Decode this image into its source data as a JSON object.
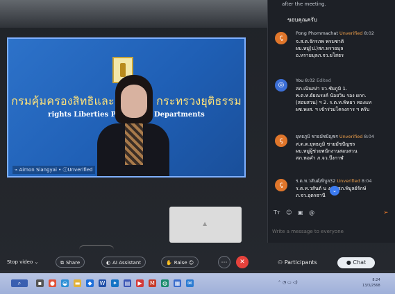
{
  "video": {
    "banner_thai": "กรมคุ้มครองสิทธิและเสรีภาพ กระทรวงยุติธรรม",
    "banner_en": "rights Liberties Protection Departments",
    "participant_name": "Aimon Siangyai",
    "participant_status": "Unverified"
  },
  "chat": {
    "header_partial": "after the meeting.",
    "thanks": "ขอบคุณครับ",
    "messages": [
      {
        "author": "Pong Phommachat",
        "badge": "Unverified",
        "time": "8:02",
        "edited": "",
        "lines": [
          "จ.ส.ต.จักรภพ พรมชาติ",
          "ผบ.หมู่(ป.)สภ.หรายมุล",
          "อ.หรายมุลภ.จว.ยโสธร"
        ]
      },
      {
        "author": "You",
        "badge": "",
        "time": "8:02",
        "edited": "Edited",
        "lines": [
          "สภ.เนินสง่า จว.ชัยภูมิ 1.",
          "พ.ต.ท.ยัยณรงค์ น้อยวิน รอง ผกก.",
          "(สอบสวน) ฯ 2. ร.ต.ท.พิทยา ทองแท",
          "ผช.พงส. ฯ เข้าร่วมโครงการ ฯ ครับ"
        ]
      },
      {
        "author": "ยุทธภูมิ ชายมัชปัญชร",
        "badge": "Unverified",
        "time": "8:04",
        "edited": "",
        "lines": [
          "ส.ต.ต.ยุทธภูมิ ชายมัชปัญชร",
          "ผบ.หมู่ผู้ช่วยพนักงานสอบสวน",
          "สภ.หอคำ ภ.จว.บึงกาฬ"
        ]
      },
      {
        "author": "ร.ต.ท.วสันต์/พิบูล32",
        "badge": "Unverified",
        "time": "8:04",
        "edited": "",
        "lines": [
          "ร.ต.ท.วสันต์ น      งศรี สภ.พิบูลย์รักษ์",
          "ภ.จว.อุดรธานี"
        ]
      }
    ],
    "composer_placeholder": "Write a message to everyone"
  },
  "toolbar": {
    "stop_video": "Stop video",
    "share": "Share",
    "ai_assistant": "AI Assistant",
    "raise": "Raise",
    "participants": "Participants",
    "chat": "Chat"
  },
  "taskbar": {
    "clock_time": "8:24",
    "clock_date": "13/3/2568"
  },
  "colors": {
    "leave_red": "#e5423c",
    "unverified_orange": "#f0a04b",
    "video_blue": "#2d72c9",
    "banner_yellow": "#ffe37a"
  }
}
